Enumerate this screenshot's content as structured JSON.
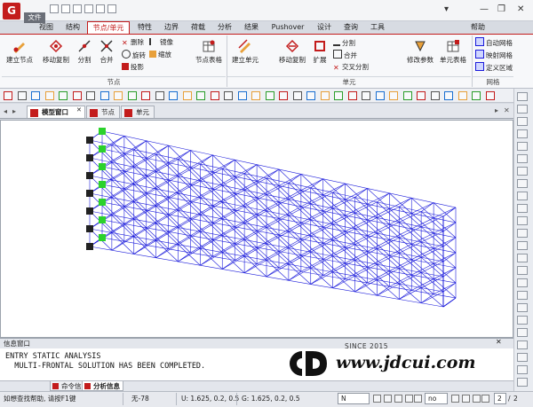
{
  "title_bar": {
    "logo_letter": "G",
    "file_menu": "文件",
    "help": "帮助",
    "controls": {
      "minimize": "—",
      "restore": "❐",
      "close": "✕",
      "caret": "▾"
    }
  },
  "ribbon_tabs": [
    {
      "label": "视图"
    },
    {
      "label": "结构"
    },
    {
      "label": "节点/单元"
    },
    {
      "label": "特性"
    },
    {
      "label": "边界"
    },
    {
      "label": "荷载"
    },
    {
      "label": "分析"
    },
    {
      "label": "结果"
    },
    {
      "label": "Pushover"
    },
    {
      "label": "设计"
    },
    {
      "label": "查询"
    },
    {
      "label": "工具"
    }
  ],
  "ribbon": {
    "node_group": {
      "label": "节点",
      "create_node": "建立节点",
      "move_copy": "移动复制",
      "divide": "分割",
      "merge": "合并",
      "delete": "删除",
      "rotate": "旋转",
      "project": "投影",
      "mirror": "镜像",
      "scale": "缩放",
      "node_table": "节点表格"
    },
    "element_group": {
      "label": "单元",
      "create_element": "建立单元",
      "move_copy": "移动复制",
      "extrude": "扩展",
      "divide": "分割",
      "merge": "合并",
      "cross_divide": "交叉分割",
      "modify_params": "修改参数",
      "element_table": "单元表格"
    },
    "mesh_group": {
      "label": "网格",
      "auto_mesh": "自动网格",
      "map_mesh": "映射网格",
      "define_area": "定义区域"
    }
  },
  "doc_tabs": [
    {
      "label": "模型窗口"
    },
    {
      "label": "节点"
    },
    {
      "label": "单元"
    }
  ],
  "info_window": {
    "title": "信息窗口",
    "lines": [
      "ENTRY STATIC ANALYSIS",
      "  MULTI-FRONTAL SOLUTION HAS BEEN COMPLETED."
    ],
    "tabs": [
      {
        "label": "命令信息"
      },
      {
        "label": "分析信息"
      }
    ]
  },
  "status_bar": {
    "help_text": "如想查找帮助, 请按F1键",
    "selection": "无-78",
    "ucs": "U: 1.625, 0.2, 0.5",
    "gcs": "G: 1.625, 0.2, 0.5",
    "unit_select": "N",
    "none_select": "no",
    "page_current": "2",
    "page_total": "2"
  },
  "watermark": {
    "since": "SINCE 2015",
    "url": "www.jdcui.com"
  },
  "colors": {
    "accent": "#c31c1c",
    "mesh": "#1a1adb",
    "support": "#2bd22b"
  }
}
